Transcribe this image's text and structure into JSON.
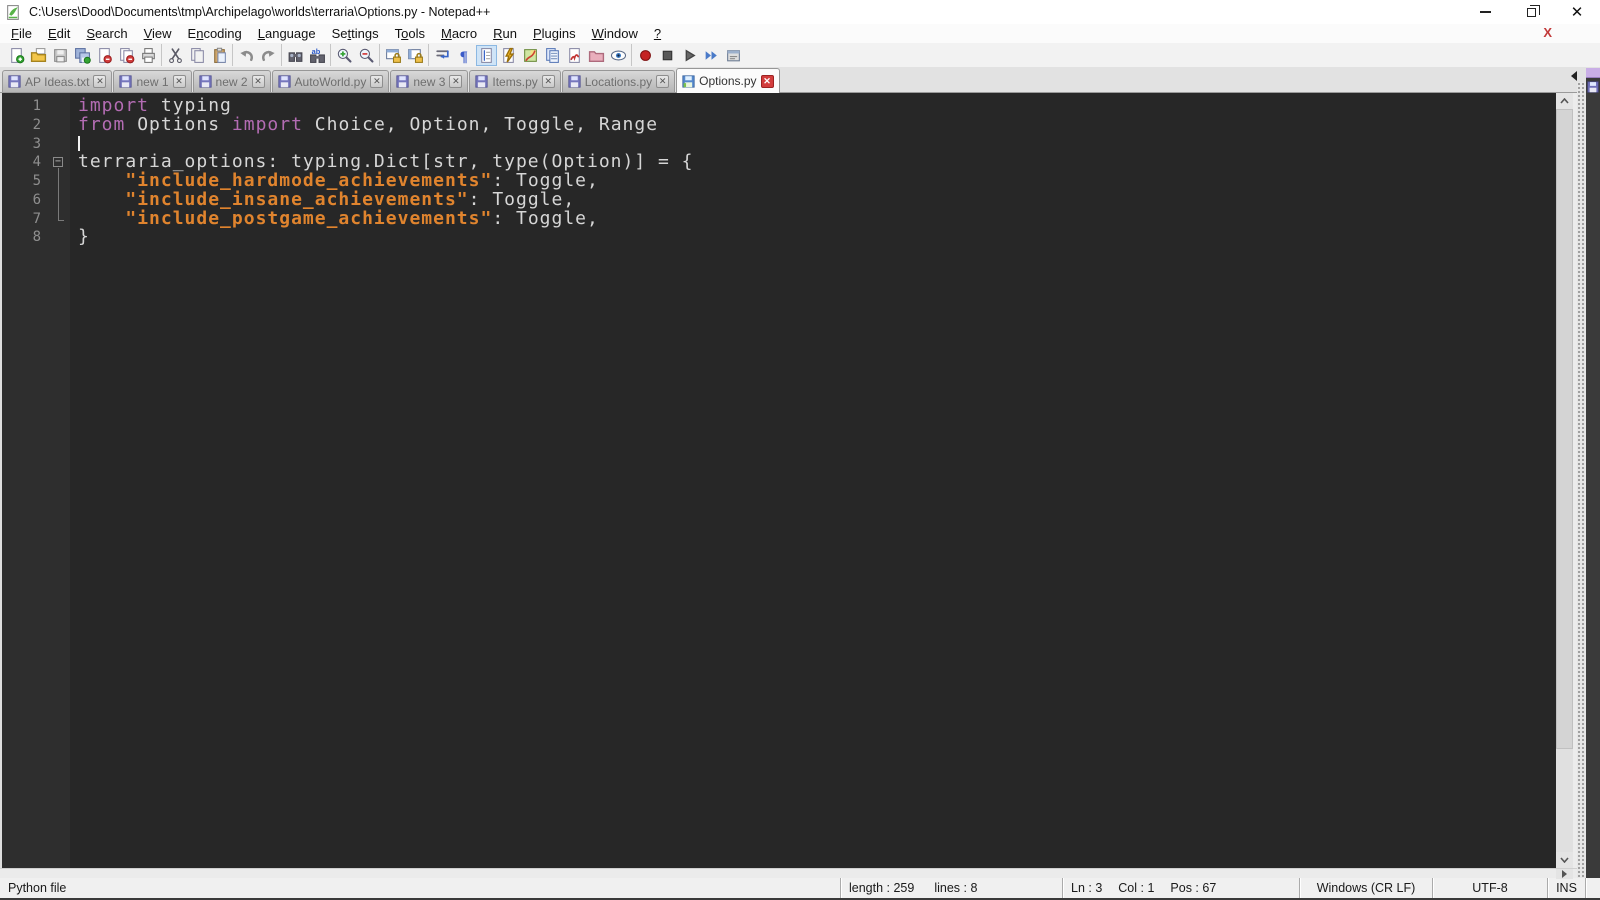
{
  "window": {
    "title": "C:\\Users\\Dood\\Documents\\tmp\\Archipelago\\worlds\\terraria\\Options.py - Notepad++"
  },
  "menubar": {
    "items": [
      {
        "id": "file",
        "label": "File",
        "mnemonic": 0
      },
      {
        "id": "edit",
        "label": "Edit",
        "mnemonic": 0
      },
      {
        "id": "search",
        "label": "Search",
        "mnemonic": 0
      },
      {
        "id": "view",
        "label": "View",
        "mnemonic": 0
      },
      {
        "id": "encoding",
        "label": "Encoding",
        "mnemonic": 1
      },
      {
        "id": "language",
        "label": "Language",
        "mnemonic": 0
      },
      {
        "id": "settings",
        "label": "Settings",
        "mnemonic": 2
      },
      {
        "id": "tools",
        "label": "Tools",
        "mnemonic": 1
      },
      {
        "id": "macro",
        "label": "Macro",
        "mnemonic": 0
      },
      {
        "id": "run",
        "label": "Run",
        "mnemonic": 0
      },
      {
        "id": "plugins",
        "label": "Plugins",
        "mnemonic": 0
      },
      {
        "id": "window",
        "label": "Window",
        "mnemonic": 0
      },
      {
        "id": "help",
        "label": "?",
        "mnemonic": 0
      }
    ],
    "close_glyph": "X"
  },
  "toolbar": {
    "active": "show-indent-guide",
    "groups": [
      [
        "new-file",
        "open-file",
        "save",
        "save-all",
        "close",
        "close-all",
        "print"
      ],
      [
        "cut",
        "copy",
        "paste"
      ],
      [
        "undo",
        "redo"
      ],
      [
        "find",
        "replace"
      ],
      [
        "zoom-in",
        "zoom-out"
      ],
      [
        "sync-vertical-scroll",
        "sync-horizontal-scroll"
      ],
      [
        "word-wrap",
        "show-all-characters",
        "show-indent-guide",
        "define-language",
        "document-map",
        "document-list",
        "function-list",
        "folder-as-workspace",
        "monitoring"
      ],
      [
        "macro-record",
        "macro-stop",
        "macro-play",
        "macro-run-multiple",
        "macro-save"
      ]
    ]
  },
  "tabs": [
    {
      "label": "AP Ideas.txt",
      "active": false
    },
    {
      "label": "new 1",
      "active": false
    },
    {
      "label": "new 2",
      "active": false
    },
    {
      "label": "AutoWorld.py",
      "active": false
    },
    {
      "label": "new 3",
      "active": false
    },
    {
      "label": "Items.py",
      "active": false
    },
    {
      "label": "Locations.py",
      "active": false
    },
    {
      "label": "Options.py",
      "active": true
    }
  ],
  "tab_close_glyph": "✕",
  "editor": {
    "lines": [
      {
        "n": "1",
        "fold": "none",
        "segs": [
          {
            "c": "kw",
            "t": "import"
          },
          {
            "c": "df",
            "t": " typing"
          }
        ]
      },
      {
        "n": "2",
        "fold": "none",
        "segs": [
          {
            "c": "kw",
            "t": "from"
          },
          {
            "c": "df",
            "t": " Options "
          },
          {
            "c": "kw",
            "t": "import"
          },
          {
            "c": "df",
            "t": " Choice, Option, Toggle, Range"
          }
        ]
      },
      {
        "n": "3",
        "fold": "none",
        "cursor": true,
        "segs": []
      },
      {
        "n": "4",
        "fold": "open",
        "segs": [
          {
            "c": "df",
            "t": "terraria_options: typing.Dict[str, type(Option)] = {"
          }
        ]
      },
      {
        "n": "5",
        "fold": "line",
        "segs": [
          {
            "c": "df",
            "t": "    "
          },
          {
            "c": "str",
            "t": "\"include_hardmode_achievements\""
          },
          {
            "c": "df",
            "t": ": Toggle,"
          }
        ]
      },
      {
        "n": "6",
        "fold": "line",
        "segs": [
          {
            "c": "df",
            "t": "    "
          },
          {
            "c": "str",
            "t": "\"include_insane_achievements\""
          },
          {
            "c": "df",
            "t": ": Toggle,"
          }
        ]
      },
      {
        "n": "7",
        "fold": "corner",
        "segs": [
          {
            "c": "df",
            "t": "    "
          },
          {
            "c": "str",
            "t": "\"include_postgame_achievements\""
          },
          {
            "c": "df",
            "t": ": Toggle,"
          }
        ]
      },
      {
        "n": "8",
        "fold": "none",
        "segs": [
          {
            "c": "df",
            "t": "}"
          }
        ]
      }
    ]
  },
  "status": {
    "doc_type": "Python file",
    "length": "length : 259",
    "lines": "lines : 8",
    "ln": "Ln : 3",
    "col": "Col : 1",
    "pos": "Pos : 67",
    "eol": "Windows (CR LF)",
    "encoding": "UTF-8",
    "insert_mode": "INS"
  },
  "colors": {
    "keyword": "#b36cb3",
    "string": "#e0842e",
    "editor_bg": "#272727",
    "accent_close": "#d23c3c"
  }
}
